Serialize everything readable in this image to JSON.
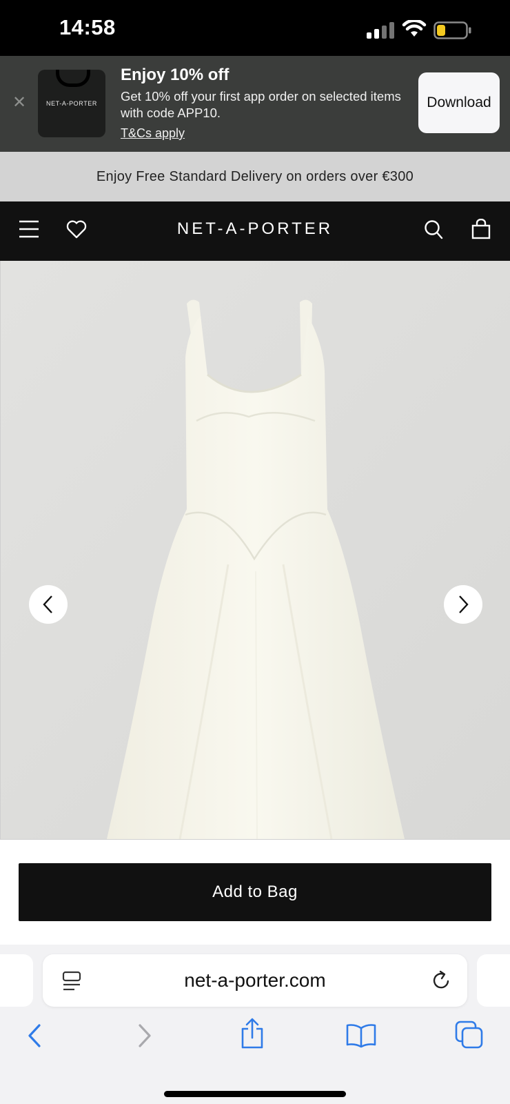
{
  "status_bar": {
    "time": "14:58"
  },
  "promo": {
    "logo_text": "NET-A-PORTER",
    "title": "Enjoy 10% off",
    "body": "Get 10% off your first app order on selected items with code APP10.",
    "terms_link": "T&Cs apply",
    "download_label": "Download"
  },
  "delivery_banner": "Enjoy Free Standard Delivery on orders over €300",
  "nav": {
    "logo": "NET-A-PORTER"
  },
  "product": {
    "add_to_bag_label": "Add to Bag"
  },
  "browser": {
    "url": "net-a-porter.com"
  },
  "icons": {
    "status": [
      "signal-icon",
      "wifi-icon",
      "battery-icon"
    ],
    "promo": [
      "close-icon"
    ],
    "nav": [
      "menu-icon",
      "heart-icon",
      "search-icon",
      "bag-icon"
    ],
    "gallery": [
      "chevron-left-icon",
      "chevron-right-icon"
    ],
    "browser": [
      "reader-icon",
      "reload-icon",
      "back-icon",
      "forward-icon",
      "share-icon",
      "bookmarks-icon",
      "tabs-icon"
    ]
  },
  "colors": {
    "promo_bg": "#3b3d3b",
    "nav_bg": "#111111",
    "delivery_bg": "#d3d3d3",
    "safari_accent": "#2f7be8",
    "battery_fill": "#f3c920"
  },
  "battery_level": 0.3
}
